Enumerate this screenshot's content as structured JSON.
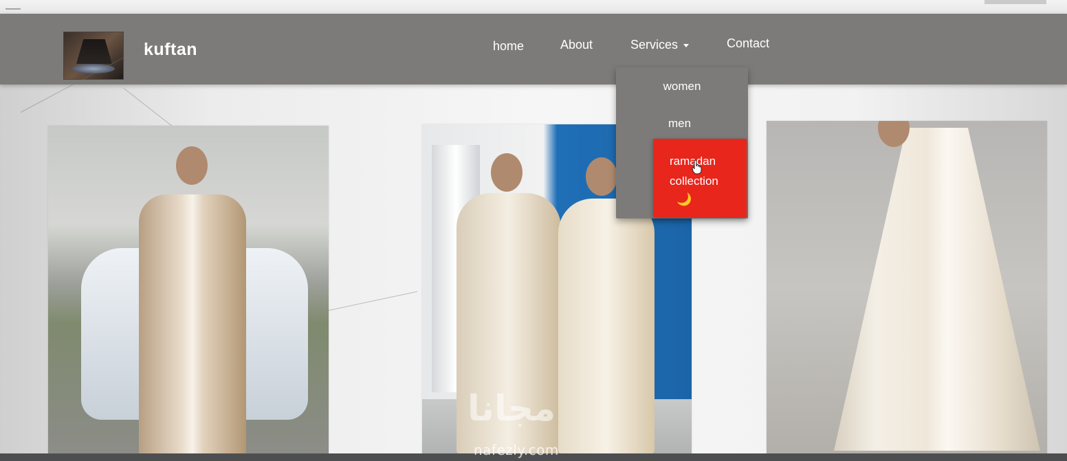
{
  "navbar": {
    "brand": "kuftan",
    "logo_icon": "lamp-logo-icon",
    "items": [
      {
        "label": "home"
      },
      {
        "label": "About"
      },
      {
        "label": "Services"
      },
      {
        "label": "Contact"
      }
    ],
    "background": "#7c7b79"
  },
  "services_dropdown": {
    "open": true,
    "items": [
      {
        "label": "women"
      },
      {
        "label": "men"
      },
      {
        "label": "ramadan\ncollection",
        "highlighted": true,
        "icon": "crescent-moon-icon",
        "icon_glyph": "🌙"
      }
    ],
    "highlight_color": "#e8261c"
  },
  "gallery": {
    "photos": [
      {
        "subject": "man in beige embroidered kaftan beside white car"
      },
      {
        "subject": "two men in cream embroidered suits by blue door"
      },
      {
        "subject": "cream embroidered cape outfit on white background"
      }
    ]
  },
  "watermarks": {
    "arabic": "مجانا",
    "site": "nafezly.com"
  }
}
